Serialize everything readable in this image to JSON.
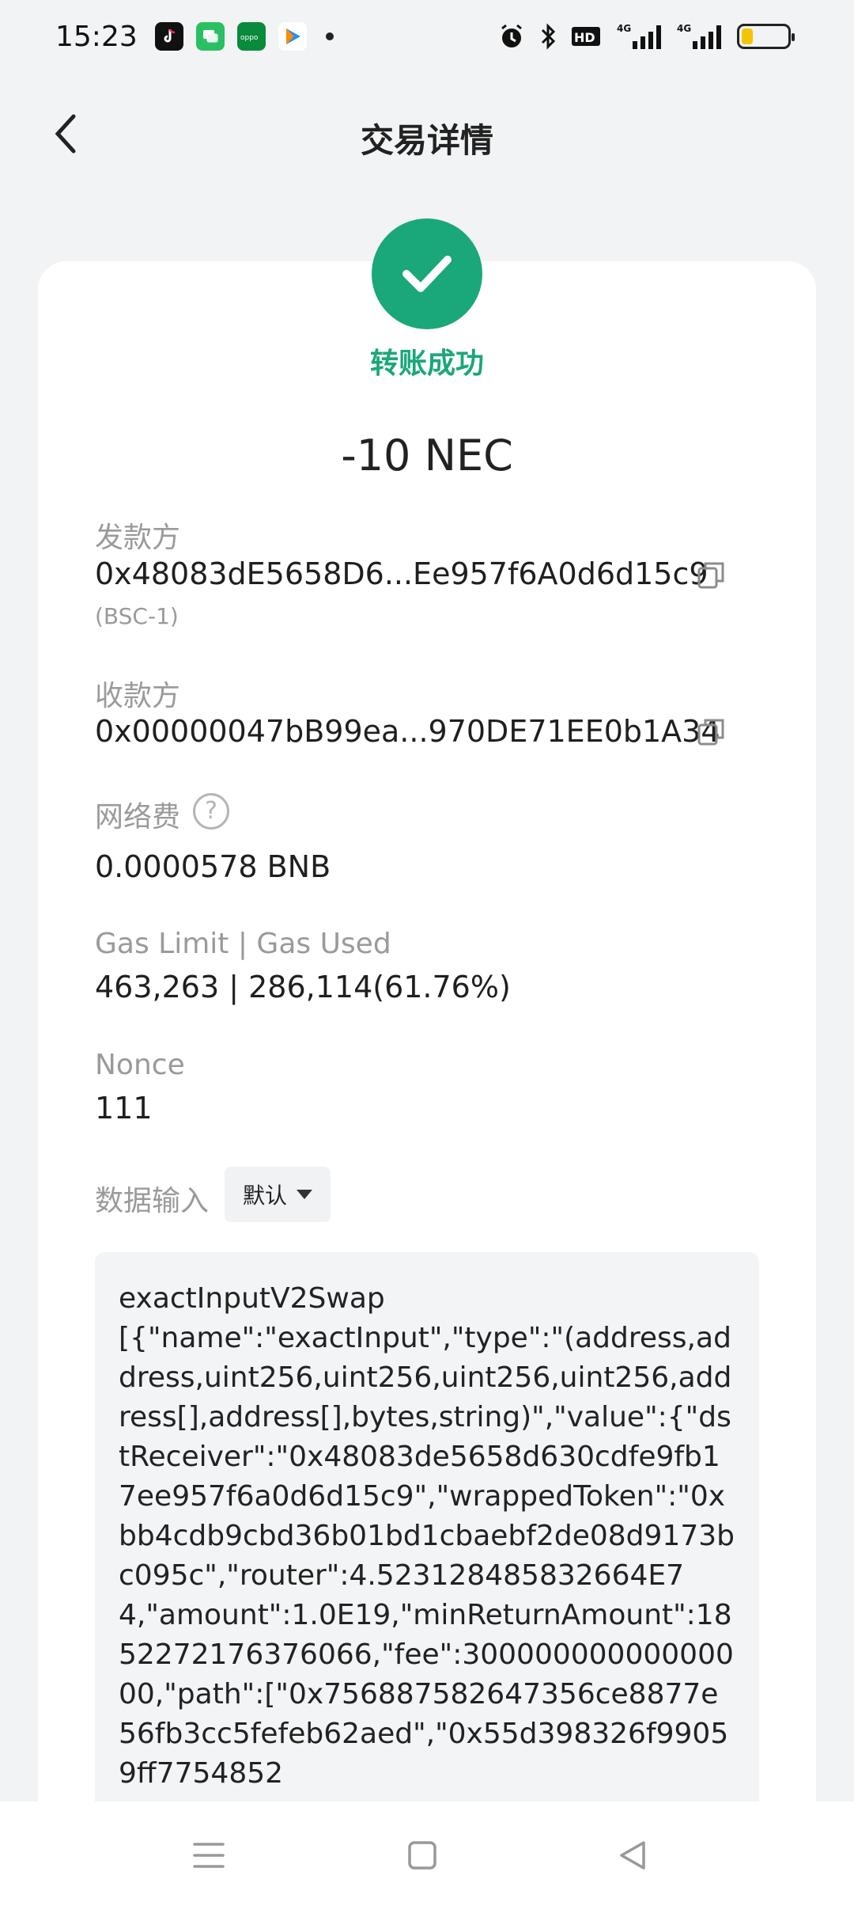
{
  "status_bar": {
    "time": "15:23",
    "apps": [
      {
        "icon": "tiktok-icon",
        "color": "#111111"
      },
      {
        "icon": "messages-icon",
        "color": "#2bbf64"
      },
      {
        "icon": "oppo-icon",
        "color": "#0a8a3c"
      },
      {
        "icon": "play-icon",
        "color": "#ffffff"
      }
    ],
    "signal_labels": [
      "HD",
      "4G",
      "4G"
    ],
    "battery_percent": 25
  },
  "header": {
    "title": "交易详情"
  },
  "status": {
    "text": "转账成功",
    "color": "#1aa77a"
  },
  "amount": "-10 NEC",
  "sender": {
    "label": "发款方",
    "address": "0x48083dE5658D6...Ee957f6A0d6d15c9",
    "network": "(BSC-1)"
  },
  "receiver": {
    "label": "收款方",
    "address": "0x00000047bB99ea...970DE71EE0b1A34"
  },
  "fee": {
    "label": "网络费",
    "help": "?",
    "value": "0.0000578 BNB"
  },
  "gas": {
    "label": "Gas Limit | Gas Used",
    "value": "463,263 | 286,114(61.76%)"
  },
  "nonce": {
    "label": "Nonce",
    "value": "111"
  },
  "data_input": {
    "label": "数据输入",
    "mode": "默认",
    "content": "exactInputV2Swap\n[{\"name\":\"exactInput\",\"type\":\"(address,address,uint256,uint256,uint256,uint256,address[],address[],bytes,string)\",\"value\":{\"dstReceiver\":\"0x48083de5658d630cdfe9fb17ee957f6a0d6d15c9\",\"wrappedToken\":\"0xbb4cdb9cbd36b01bd1cbaebf2de08d9173bc095c\",\"router\":4.523128485832664E74,\"amount\":1.0E19,\"minReturnAmount\":1852272176376066,\"fee\":30000000000000000,\"path\":[\"0x756887582647356ce8877e56fb3cc5fefeb62aed\",\"0x55d398326f99059ff7754852"
  }
}
